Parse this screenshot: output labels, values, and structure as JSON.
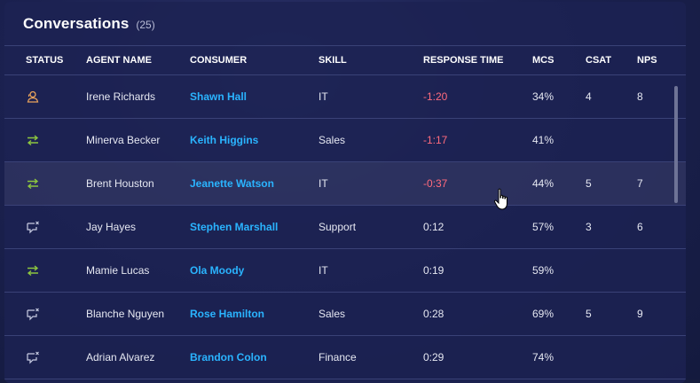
{
  "header": {
    "title": "Conversations",
    "count": "(25)"
  },
  "columns": {
    "status": "STATUS",
    "agent": "AGENT NAME",
    "consumer": "CONSUMER",
    "skill": "SKILL",
    "response_time": "RESPONSE TIME",
    "mcs": "MCS",
    "csat": "CSAT",
    "nps": "NPS"
  },
  "rows": [
    {
      "status": "agent-person-icon",
      "agent": "Irene Richards",
      "consumer": "Shawn Hall",
      "skill": "IT",
      "response_time": "-1:20",
      "mcs": "34%",
      "csat": "4",
      "nps": "8"
    },
    {
      "status": "transfer-arrows-icon",
      "agent": "Minerva Becker",
      "consumer": "Keith Higgins",
      "skill": "Sales",
      "response_time": "-1:17",
      "mcs": "41%",
      "csat": "",
      "nps": ""
    },
    {
      "status": "transfer-arrows-icon",
      "agent": "Brent Houston",
      "consumer": "Jeanette Watson",
      "skill": "IT",
      "response_time": "-0:37",
      "mcs": "44%",
      "csat": "5",
      "nps": "7"
    },
    {
      "status": "chat-closed-icon",
      "agent": "Jay Hayes",
      "consumer": "Stephen Marshall",
      "skill": "Support",
      "response_time": "0:12",
      "mcs": "57%",
      "csat": "3",
      "nps": "6"
    },
    {
      "status": "transfer-arrows-icon",
      "agent": "Mamie Lucas",
      "consumer": "Ola Moody",
      "skill": "IT",
      "response_time": "0:19",
      "mcs": "59%",
      "csat": "",
      "nps": ""
    },
    {
      "status": "chat-closed-icon",
      "agent": "Blanche Nguyen",
      "consumer": "Rose Hamilton",
      "skill": "Sales",
      "response_time": "0:28",
      "mcs": "69%",
      "csat": "5",
      "nps": "9"
    },
    {
      "status": "chat-closed-icon",
      "agent": "Adrian Alvarez",
      "consumer": "Brandon Colon",
      "skill": "Finance",
      "response_time": "0:29",
      "mcs": "74%",
      "csat": "",
      "nps": ""
    }
  ],
  "colors": {
    "agent_icon": "#e8a35c",
    "transfer_icon": "#8cc63f",
    "chat_icon": "#c9cde3",
    "consumer_link": "#2ab4ff",
    "negative_time": "#ff6b7d"
  }
}
